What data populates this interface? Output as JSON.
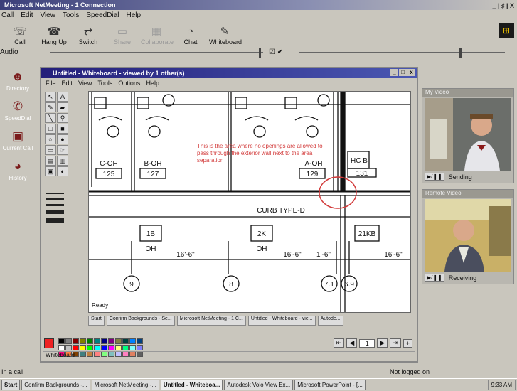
{
  "window": {
    "title": "Microsoft NetMeeting - 1 Connection",
    "controls": "_ | ♯ | X"
  },
  "menu": [
    "Call",
    "Edit",
    "View",
    "Tools",
    "SpeedDial",
    "Help"
  ],
  "toolbar": [
    {
      "label": "Call",
      "icon": "call-icon"
    },
    {
      "label": "Hang Up",
      "icon": "hang-up-icon"
    },
    {
      "label": "Switch",
      "icon": "switch-icon"
    },
    {
      "label": "Share",
      "icon": "share-icon"
    },
    {
      "label": "Collaborate",
      "icon": "collaborate-icon"
    },
    {
      "label": "Chat",
      "icon": "chat-icon"
    },
    {
      "label": "Whiteboard",
      "icon": "whiteboard-icon"
    }
  ],
  "audio": {
    "label": "Audio"
  },
  "left": [
    {
      "label": "Directory"
    },
    {
      "label": "SpeedDial"
    },
    {
      "label": "Current Call"
    },
    {
      "label": "History"
    }
  ],
  "video": {
    "top": {
      "title": "My Video",
      "status": "Sending"
    },
    "bottom": {
      "title": "Remote Video",
      "status": "Receiving"
    }
  },
  "whiteboard": {
    "title": "Untitled - Whiteboard - viewed by 1 other(s)",
    "menu": [
      "File",
      "Edit",
      "View",
      "Tools",
      "Options",
      "Help"
    ],
    "annotation": "This is the area where no openings are allowed to pass through the exterior wall next to the area separation",
    "drawing_labels": {
      "rooms": [
        "C-OH",
        "B-OH",
        "A-OH",
        "HC B"
      ],
      "room_nums": [
        "125",
        "127",
        "129",
        "131"
      ],
      "curb": "CURB TYPE-D",
      "units": [
        "1B",
        "2K",
        "21KB"
      ],
      "oh": [
        "OH",
        "OH"
      ],
      "dims": [
        "16'-6\"",
        "16'-6\"",
        "1'-6\"",
        "16'-6\""
      ],
      "grid": [
        "9",
        "8",
        "7.1",
        "6.9"
      ]
    },
    "status": "Ready",
    "sub_taskbar": [
      "Start",
      "Confirm Backgrounds - Se...",
      "Microsoft NetMeeting - 1 C...",
      "Untitled - Whiteboard - vie...",
      "Autode..."
    ],
    "page": "1",
    "footer": "Whiteboard",
    "palette": [
      "#000000",
      "#808080",
      "#800000",
      "#808000",
      "#008000",
      "#008080",
      "#000080",
      "#800080",
      "#808040",
      "#004040",
      "#0080ff",
      "#004080",
      "#ffffff",
      "#c0c0c0",
      "#ff0000",
      "#ffff00",
      "#00ff00",
      "#00ffff",
      "#0000ff",
      "#ff00ff",
      "#ffff80",
      "#00ff80",
      "#80ffff",
      "#8080ff",
      "#ff0080",
      "#ff8040",
      "#804000",
      "#408080",
      "#c08040",
      "#ff8080",
      "#80ff80",
      "#80c0c0",
      "#c0c0ff",
      "#ff80c0",
      "#e08060",
      "#606060"
    ],
    "selected_color": "#ee2222"
  },
  "statusbar": {
    "left": "In a call",
    "right": "Not logged on"
  },
  "taskbar": {
    "start": "Start",
    "items": [
      "Confirm Backgrounds -...",
      "Microsoft NetMeeting -...",
      "Untitled - Whiteboa...",
      "Autodesk Volo View Ex...",
      "Microsoft PowerPoint - [..."
    ],
    "active_index": 2,
    "clock": "9:33 AM"
  }
}
